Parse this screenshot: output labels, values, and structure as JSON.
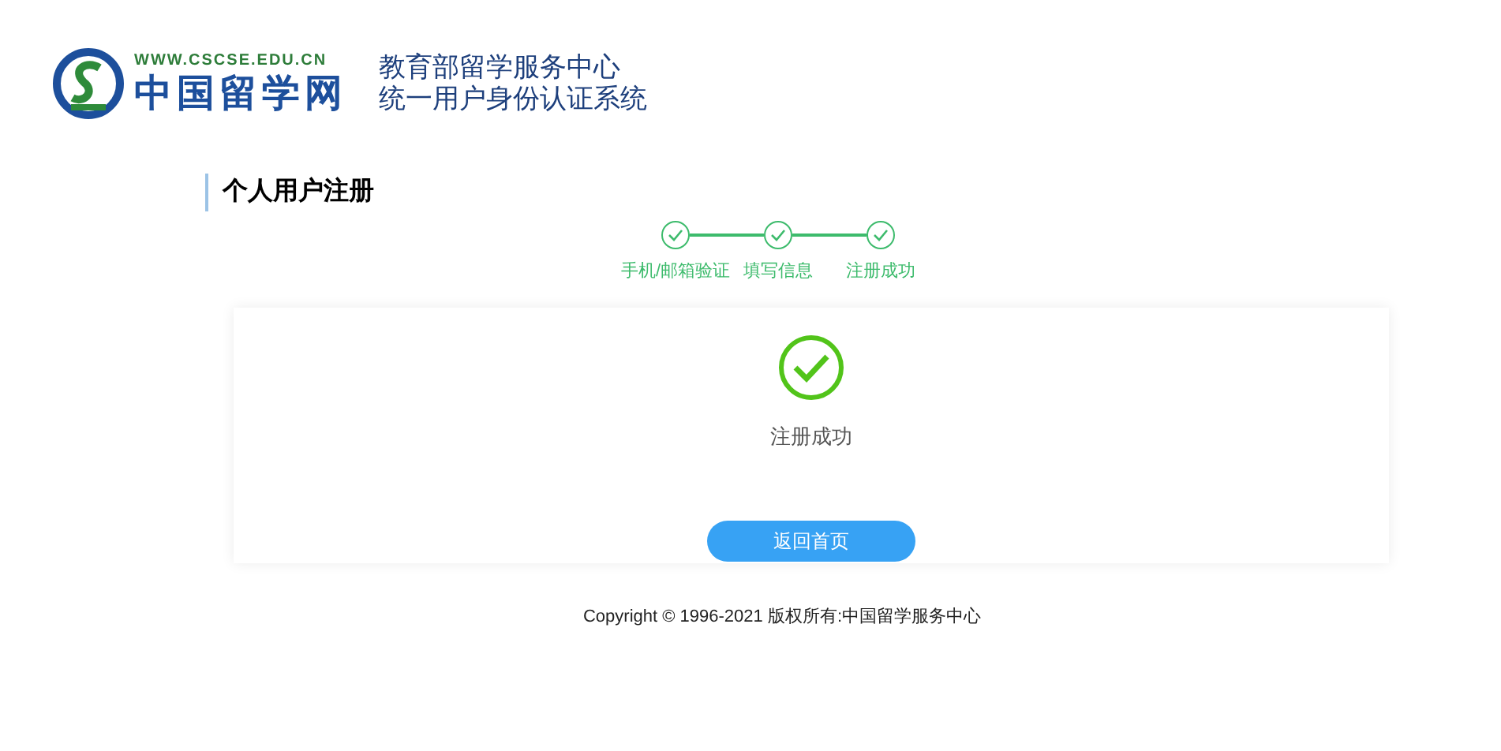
{
  "header": {
    "logo_url": "WWW.CSCSE.EDU.CN",
    "logo_name": "中国留学网",
    "org": "教育部留学服务中心",
    "system": "统一用户身份认证系统"
  },
  "page_title": "个人用户注册",
  "steps": [
    {
      "label": "手机/邮箱验证",
      "done": true
    },
    {
      "label": "填写信息",
      "done": true
    },
    {
      "label": "注册成功",
      "done": true
    }
  ],
  "result": {
    "message": "注册成功",
    "button": "返回首页"
  },
  "footer": "Copyright © 1996-2021 版权所有:中国留学服务中心"
}
